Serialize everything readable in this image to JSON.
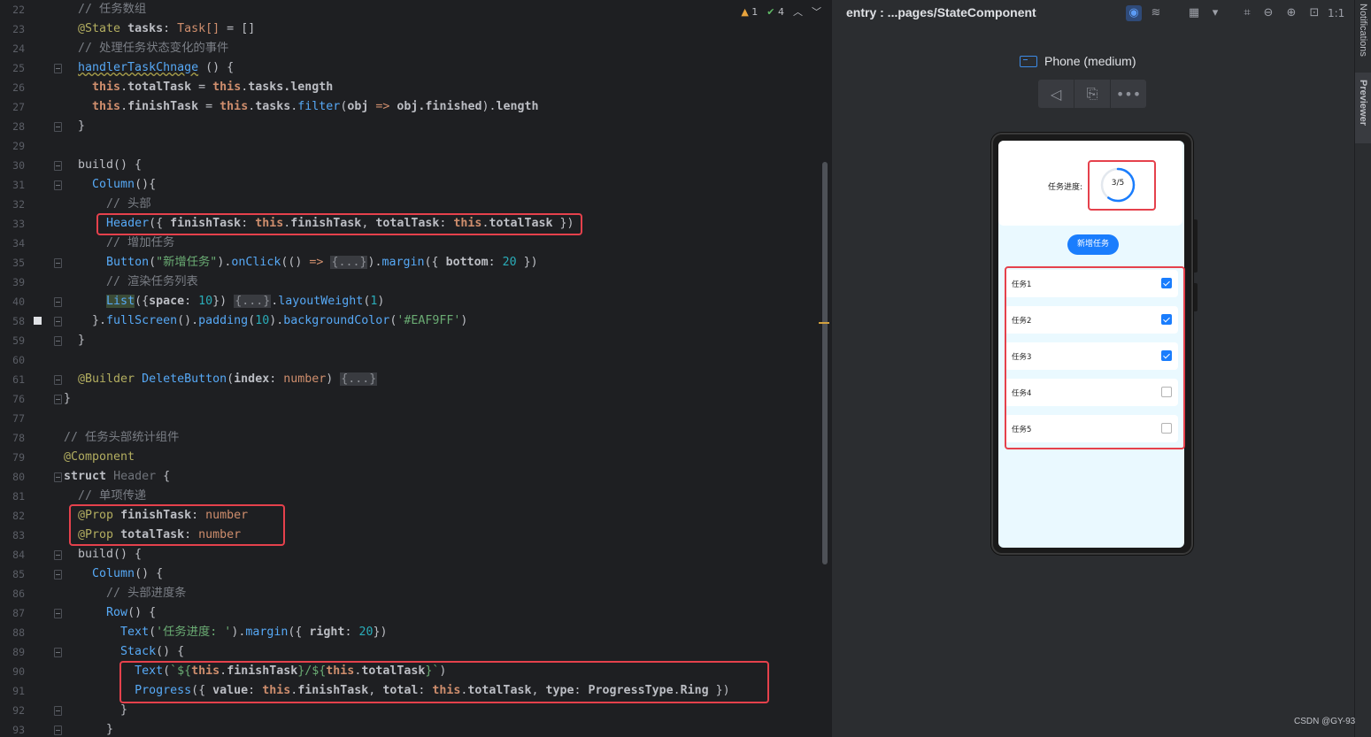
{
  "editor": {
    "inspections": {
      "warnings": "1",
      "weak_warnings": "4"
    },
    "lines": [
      {
        "n": "22",
        "t": "cm",
        "text": "  // 任务数组"
      },
      {
        "n": "23",
        "t": "state"
      },
      {
        "n": "24",
        "t": "cm",
        "text": "  // 处理任务状态变化的事件"
      },
      {
        "n": "25",
        "t": "handler"
      },
      {
        "n": "26",
        "t": "l26"
      },
      {
        "n": "27",
        "t": "l27"
      },
      {
        "n": "28",
        "t": "plain",
        "text": "  }"
      },
      {
        "n": "29",
        "t": "plain",
        "text": ""
      },
      {
        "n": "30",
        "t": "plain_build",
        "text": "  build() {"
      },
      {
        "n": "31",
        "t": "column",
        "text": "    Column(){"
      },
      {
        "n": "32",
        "t": "cm",
        "text": "      // 头部"
      },
      {
        "n": "33",
        "t": "header"
      },
      {
        "n": "34",
        "t": "cm",
        "text": "      // 增加任务"
      },
      {
        "n": "35",
        "t": "button"
      },
      {
        "n": "39",
        "t": "cm",
        "text": "      // 渲染任务列表"
      },
      {
        "n": "40",
        "t": "list"
      },
      {
        "n": "58",
        "t": "full"
      },
      {
        "n": "59",
        "t": "plain",
        "text": "  }"
      },
      {
        "n": "60",
        "t": "plain",
        "text": ""
      },
      {
        "n": "61",
        "t": "builder"
      },
      {
        "n": "76",
        "t": "plain",
        "text": "}"
      },
      {
        "n": "77",
        "t": "plain",
        "text": ""
      },
      {
        "n": "78",
        "t": "cm",
        "text": "// 任务头部统计组件"
      },
      {
        "n": "79",
        "t": "component"
      },
      {
        "n": "80",
        "t": "struct"
      },
      {
        "n": "81",
        "t": "cm",
        "text": "  // 单项传递"
      },
      {
        "n": "82",
        "t": "prop1"
      },
      {
        "n": "83",
        "t": "prop2"
      },
      {
        "n": "84",
        "t": "plain_build",
        "text": "  build() {"
      },
      {
        "n": "85",
        "t": "column2"
      },
      {
        "n": "86",
        "t": "cm",
        "text": "      // 头部进度条"
      },
      {
        "n": "87",
        "t": "row"
      },
      {
        "n": "88",
        "t": "text1"
      },
      {
        "n": "89",
        "t": "stack"
      },
      {
        "n": "90",
        "t": "text2"
      },
      {
        "n": "91",
        "t": "progress"
      },
      {
        "n": "92",
        "t": "plain",
        "text": "        }"
      },
      {
        "n": "93",
        "t": "plain",
        "text": "      }"
      }
    ],
    "tokens": {
      "state_decorator": "@State",
      "tasks": "tasks",
      "task_type": "Task[]",
      "handler_name": "handlerTaskChnage",
      "this": "this",
      "totalTask": "totalTask",
      "finishTask": "finishTask",
      "tasks_length": "tasks.length",
      "filter": "filter",
      "obj": "obj",
      "finished": "obj.finished",
      "length": "length",
      "header_call": "Header",
      "button_call": "Button",
      "button_str": "\"新增任务\"",
      "onClick": "onClick",
      "margin": "margin",
      "bottom": "bottom",
      "twenty": "20",
      "list_call": "List",
      "space": "space",
      "ten": "10",
      "layoutWeight": "layoutWeight",
      "one": "1",
      "fullScreen": "fullScreen",
      "padding": "padding",
      "backgroundColor": "backgroundColor",
      "bg_str": "'#EAF9FF'",
      "builder_dec": "@Builder",
      "delete_button": "DeleteButton",
      "index": "index",
      "number": "number",
      "component_dec": "@Component",
      "struct_kw": "struct",
      "header_name": "Header",
      "prop_dec": "@Prop",
      "column_call": "Column",
      "row_call": "Row",
      "text_call": "Text",
      "progress_label_str": "'任务进度: '",
      "right": "right",
      "stack_call": "Stack",
      "template_open": "`${",
      "template_mid": "}/${",
      "template_close": "}`",
      "progress_call": "Progress",
      "value": "value",
      "total": "total",
      "type": "type",
      "progress_type": "ProgressType",
      "ring": "Ring",
      "fold": "{...}",
      "arrow": "=>",
      "build": "build"
    }
  },
  "previewer": {
    "title": "entry : ...pages/StateComponent",
    "device": "Phone (medium)",
    "zoom_label": "1:1",
    "app": {
      "progress_label": "任务进度:",
      "progress_text": "3/5",
      "progress_value": 0.6,
      "add_button": "新增任务",
      "tasks": [
        {
          "name": "任务1",
          "finished": true
        },
        {
          "name": "任务2",
          "finished": true
        },
        {
          "name": "任务3",
          "finished": true
        },
        {
          "name": "任务4",
          "finished": false
        },
        {
          "name": "任务5",
          "finished": false
        }
      ]
    }
  },
  "rail": {
    "notifications": "Notifications",
    "previewer": "Previewer"
  },
  "watermark": "CSDN @GY-93",
  "colors": {
    "accent": "#1a7dfd",
    "highlight_box": "#e5414c",
    "app_bg": "#eaf9ff"
  }
}
